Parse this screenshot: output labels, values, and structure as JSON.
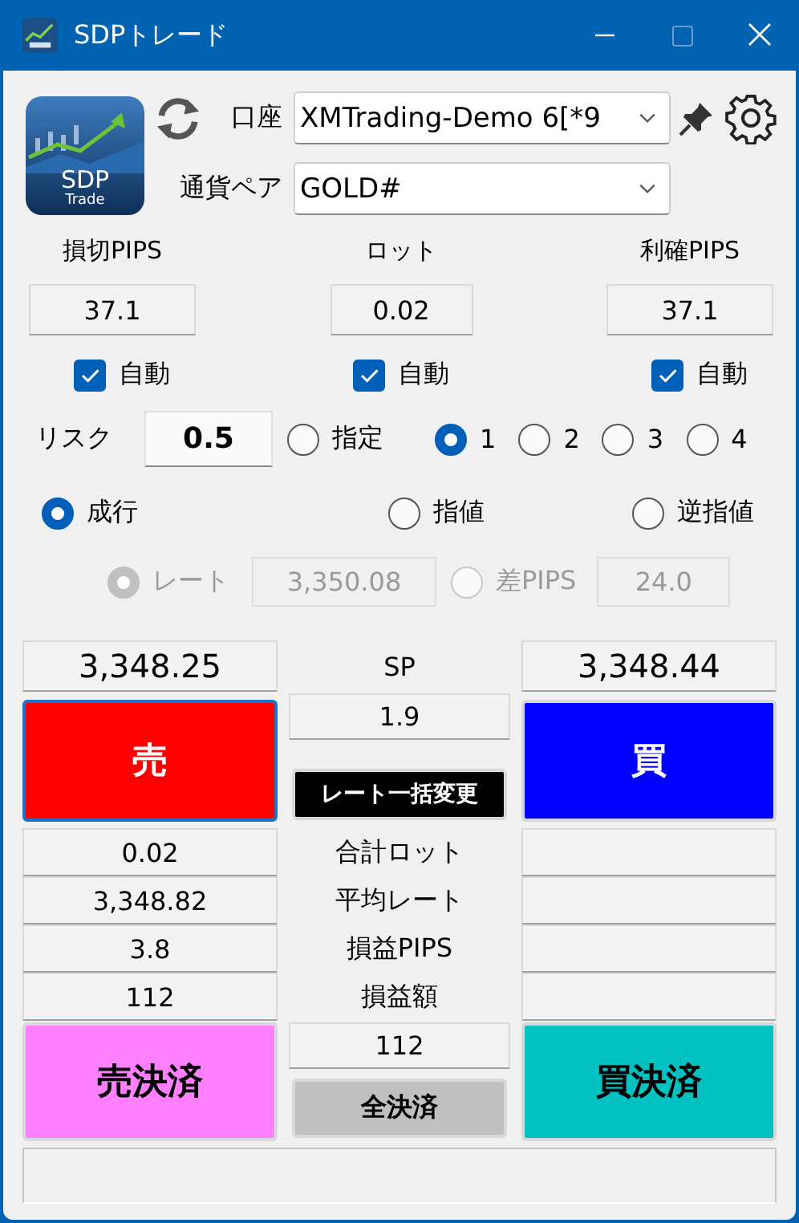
{
  "window": {
    "title": "SDPトレード"
  },
  "logo": {
    "title": "SDP",
    "subtitle": "Trade"
  },
  "account": {
    "label": "口座",
    "value": "XMTrading-Demo 6[*9"
  },
  "pair": {
    "label": "通貨ペア",
    "value": "GOLD#"
  },
  "settings": [
    {
      "label": "損切PIPS",
      "value": "37.1",
      "auto_label": "自動",
      "checked": true
    },
    {
      "label": "ロット",
      "value": "0.02",
      "auto_label": "自動",
      "checked": true
    },
    {
      "label": "利確PIPS",
      "value": "37.1",
      "auto_label": "自動",
      "checked": true
    }
  ],
  "risk": {
    "label": "リスク",
    "value": "0.5",
    "options": [
      {
        "label": "指定",
        "selected": false
      },
      {
        "label": "1",
        "selected": true
      },
      {
        "label": "2",
        "selected": false
      },
      {
        "label": "3",
        "selected": false
      },
      {
        "label": "4",
        "selected": false
      }
    ]
  },
  "order_types": [
    {
      "label": "成行",
      "selected": true
    },
    {
      "label": "指値",
      "selected": false
    },
    {
      "label": "逆指値",
      "selected": false
    }
  ],
  "rate_inputs": [
    {
      "label": "レート",
      "value": "3,350.08",
      "selected": true,
      "disabled": true
    },
    {
      "label": "差PIPS",
      "value": "24.0",
      "selected": false,
      "disabled": true
    }
  ],
  "quotes": {
    "bid": "3,348.25",
    "sp_label": "SP",
    "sp": "1.9",
    "ask": "3,348.44"
  },
  "sell_button": "売",
  "buy_button": "買",
  "bulk_change_button": "レート一括変更",
  "summary": [
    {
      "label": "合計ロット",
      "sell": "0.02"
    },
    {
      "label": "平均レート",
      "sell": "3,348.82"
    },
    {
      "label": "損益PIPS",
      "sell": "3.8"
    },
    {
      "label": "損益額",
      "sell": "112"
    }
  ],
  "total": "112",
  "close_sell_button": "売決済",
  "close_all_button": "全決済",
  "close_buy_button": "買決済"
}
